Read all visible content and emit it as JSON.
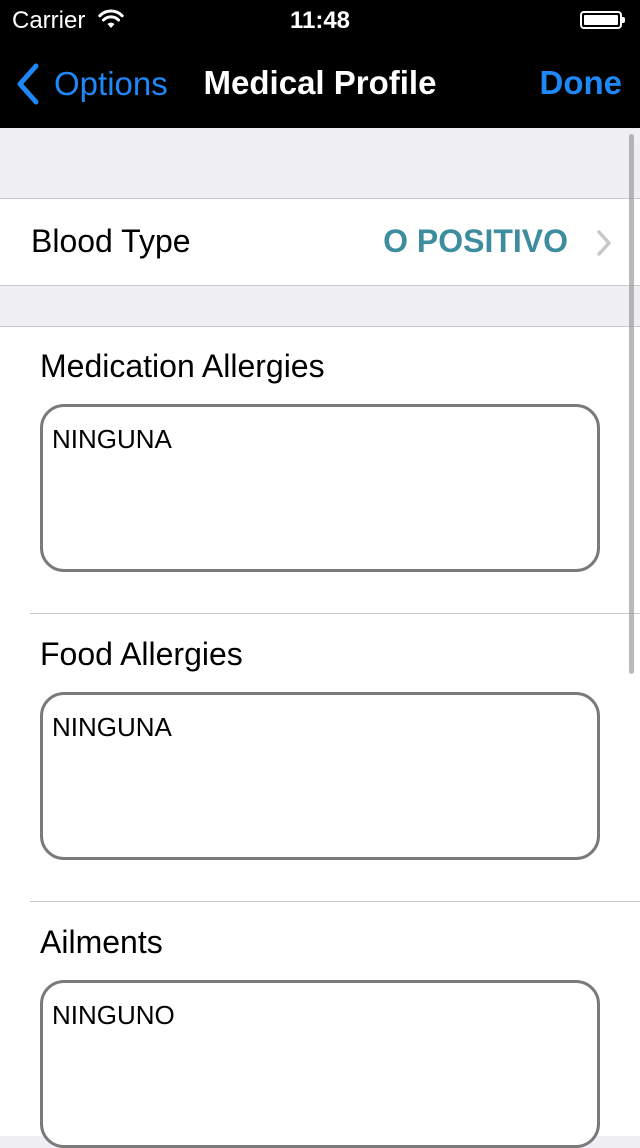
{
  "status_bar": {
    "carrier": "Carrier",
    "time": "11:48"
  },
  "nav": {
    "back_label": "Options",
    "title": "Medical Profile",
    "done_label": "Done"
  },
  "blood_type": {
    "label": "Blood Type",
    "value": "O POSITIVO"
  },
  "fields": [
    {
      "label": "Medication Allergies",
      "value": "NINGUNA"
    },
    {
      "label": "Food Allergies",
      "value": "NINGUNA"
    },
    {
      "label": "Ailments",
      "value": "NINGUNO"
    }
  ],
  "colors": {
    "accent": "#1e88f7",
    "blood_value": "#3e8d9f",
    "bar_background": "#000000",
    "group_background": "#efeff4"
  },
  "icons": [
    "wifi-icon",
    "battery-icon",
    "back-chevron-icon",
    "chevron-right-icon"
  ]
}
